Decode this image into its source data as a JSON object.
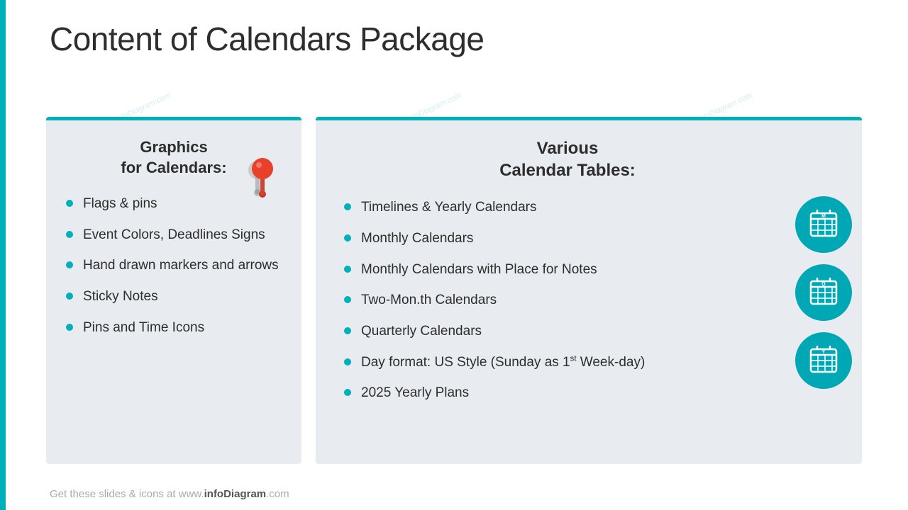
{
  "title": "Content of Calendars Package",
  "left_column": {
    "heading_line1": "Graphics",
    "heading_line2": "for Calendars:",
    "items": [
      "Flags & pins",
      "Event Colors, Deadlines Signs",
      "Hand drawn markers and arrows",
      "Sticky Notes",
      "Pins and Time Icons"
    ]
  },
  "right_column": {
    "heading_line1": "Various",
    "heading_line2": "Calendar Tables:",
    "items": [
      "Timelines & Yearly Calendars",
      "Monthly Calendars",
      "Monthly Calendars with Place for Notes",
      "Two-Mon.th Calendars",
      "Quarterly Calendars",
      "Day format: US Style (Sunday as 1st Week-day)",
      "2025 Yearly Plans"
    ],
    "icons": [
      {
        "label": "M",
        "aria": "monthly-calendar-icon"
      },
      {
        "label": "Q",
        "aria": "quarterly-calendar-icon"
      },
      {
        "label": "Y",
        "aria": "yearly-calendar-icon"
      }
    ]
  },
  "footer": {
    "text_normal": "Get these slides & icons at www.",
    "text_bold": "infoDiagram",
    "text_end": ".com"
  },
  "watermarks": [
    "© infoDiagram.com",
    "© infoDiagram.com",
    "© infoDiagram.com"
  ]
}
